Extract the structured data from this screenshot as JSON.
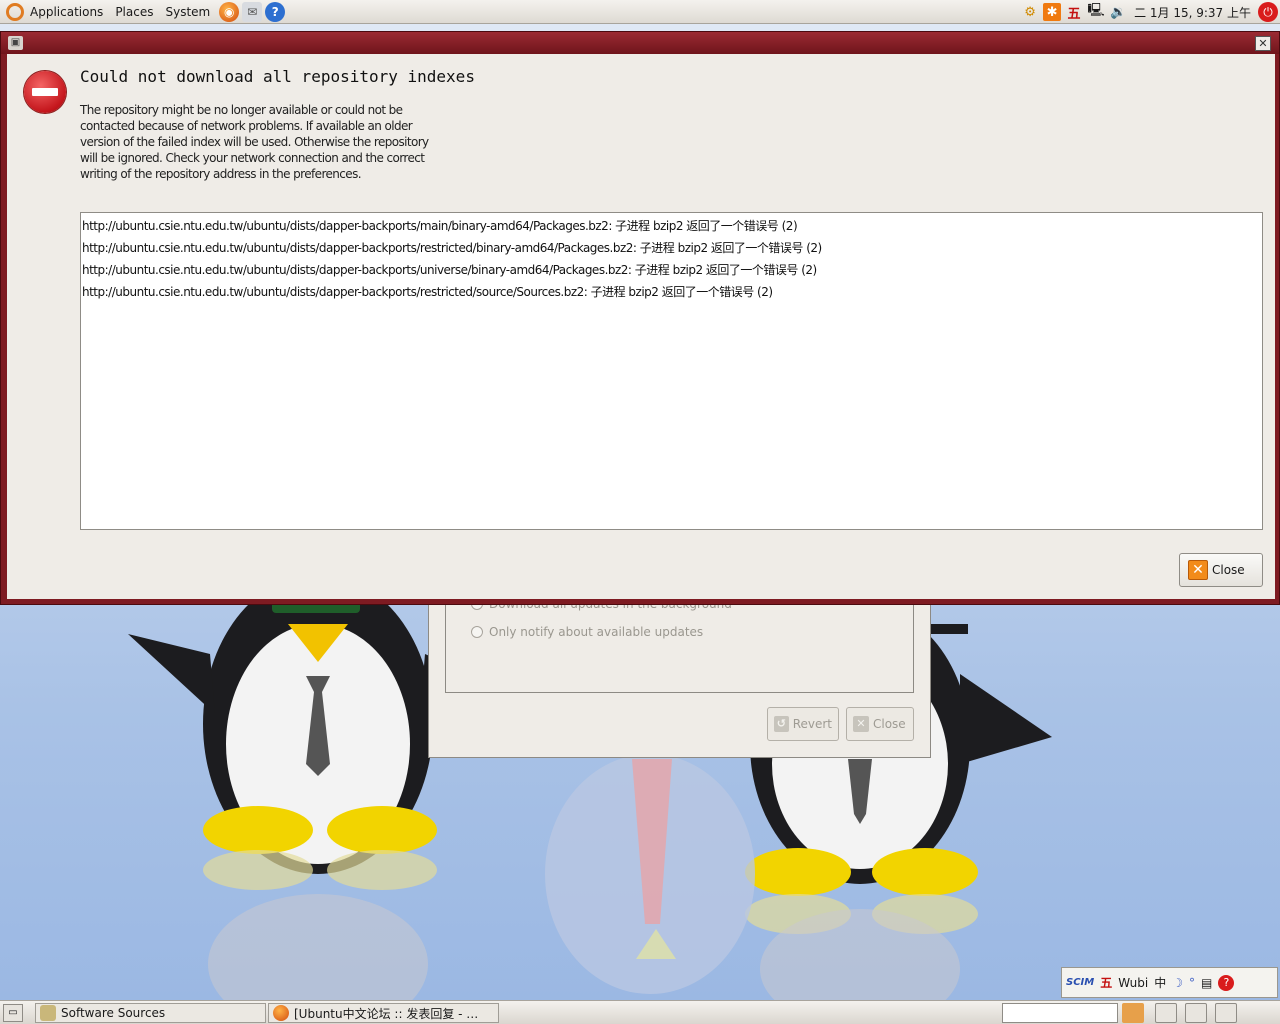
{
  "top_panel": {
    "menus": [
      "Applications",
      "Places",
      "System"
    ],
    "clock": "二 1月 15, 9:37 上午",
    "ime_indicator": "五"
  },
  "background_dialog": {
    "radio_background": "Download all updates in the background",
    "radio_notify": "Only notify about available updates",
    "revert_label": "Revert",
    "close_label": "Close"
  },
  "error_dialog": {
    "title": "Could not download all repository indexes",
    "description": "The repository might be no longer available or could not be contacted because of network problems. If available an older version of the failed index will be used. Otherwise the repository will be ignored. Check your network connection and the correct writing of the repository address in the preferences.",
    "errors": [
      "http://ubuntu.csie.ntu.edu.tw/ubuntu/dists/dapper-backports/main/binary-amd64/Packages.bz2: 子进程 bzip2 返回了一个错误号 (2)",
      "http://ubuntu.csie.ntu.edu.tw/ubuntu/dists/dapper-backports/restricted/binary-amd64/Packages.bz2: 子进程 bzip2 返回了一个错误号 (2)",
      "http://ubuntu.csie.ntu.edu.tw/ubuntu/dists/dapper-backports/universe/binary-amd64/Packages.bz2: 子进程 bzip2 返回了一个错误号 (2)",
      "http://ubuntu.csie.ntu.edu.tw/ubuntu/dists/dapper-backports/restricted/source/Sources.bz2: 子进程 bzip2 返回了一个错误号 (2)"
    ],
    "close_label": "Close"
  },
  "ime_bar": {
    "logo": "SCIM",
    "input_method_glyph": "五",
    "input_method_name": "Wubi",
    "mode": "中"
  },
  "taskbar": {
    "tasks": [
      "Software Sources",
      "[Ubuntu中文论坛 :: 发表回复 - …"
    ]
  },
  "colors": {
    "error_red": "#c4161c",
    "titlebar": "#7e1b22",
    "dialog_bg": "#efece7",
    "close_icon": "#f28b1a"
  }
}
